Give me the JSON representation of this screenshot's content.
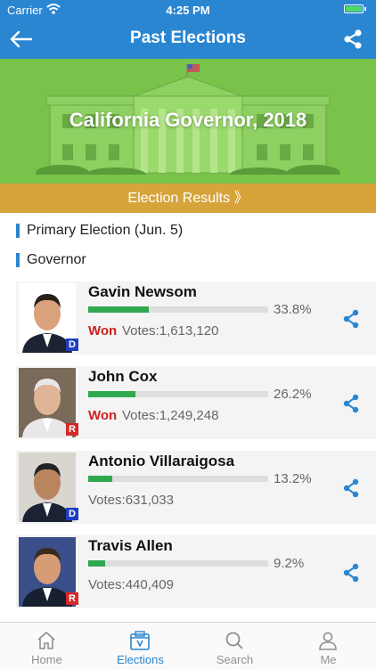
{
  "status_bar": {
    "carrier": "Carrier",
    "time": "4:25 PM",
    "battery_level": 1.0
  },
  "nav": {
    "title": "Past Elections",
    "back_icon": "arrow-left-icon",
    "share_icon": "share-icon"
  },
  "banner": {
    "title": "California Governor, 2018",
    "results_label": "Election Results 》"
  },
  "sections": {
    "election": "Primary Election (Jun. 5)",
    "office": "Governor"
  },
  "candidates": [
    {
      "name": "Gavin Newsom",
      "percent": "33.8%",
      "share": 0.338,
      "won_label": "Won",
      "votes": "Votes:1,613,120",
      "party": "D",
      "party_color": "#1f3fbf"
    },
    {
      "name": "John Cox",
      "percent": "26.2%",
      "share": 0.262,
      "won_label": "Won",
      "votes": "Votes:1,249,248",
      "party": "R",
      "party_color": "#d62828"
    },
    {
      "name": "Antonio Villaraigosa",
      "percent": "13.2%",
      "share": 0.132,
      "won_label": "",
      "votes": "Votes:631,033",
      "party": "D",
      "party_color": "#1f3fbf"
    },
    {
      "name": "Travis Allen",
      "percent": "9.2%",
      "share": 0.092,
      "won_label": "",
      "votes": "Votes:440,409",
      "party": "R",
      "party_color": "#d62828"
    }
  ],
  "tabs": [
    {
      "label": "Home",
      "icon": "home-icon",
      "active": false
    },
    {
      "label": "Elections",
      "icon": "ballot-box-icon",
      "active": true
    },
    {
      "label": "Search",
      "icon": "search-icon",
      "active": false
    },
    {
      "label": "Me",
      "icon": "person-icon",
      "active": false
    }
  ],
  "colors": {
    "accent": "#2a86d1",
    "banner_green": "#79c34a",
    "results_gold": "#d6a43a",
    "won_red": "#cc2222",
    "bar_green": "#2fa84f"
  }
}
